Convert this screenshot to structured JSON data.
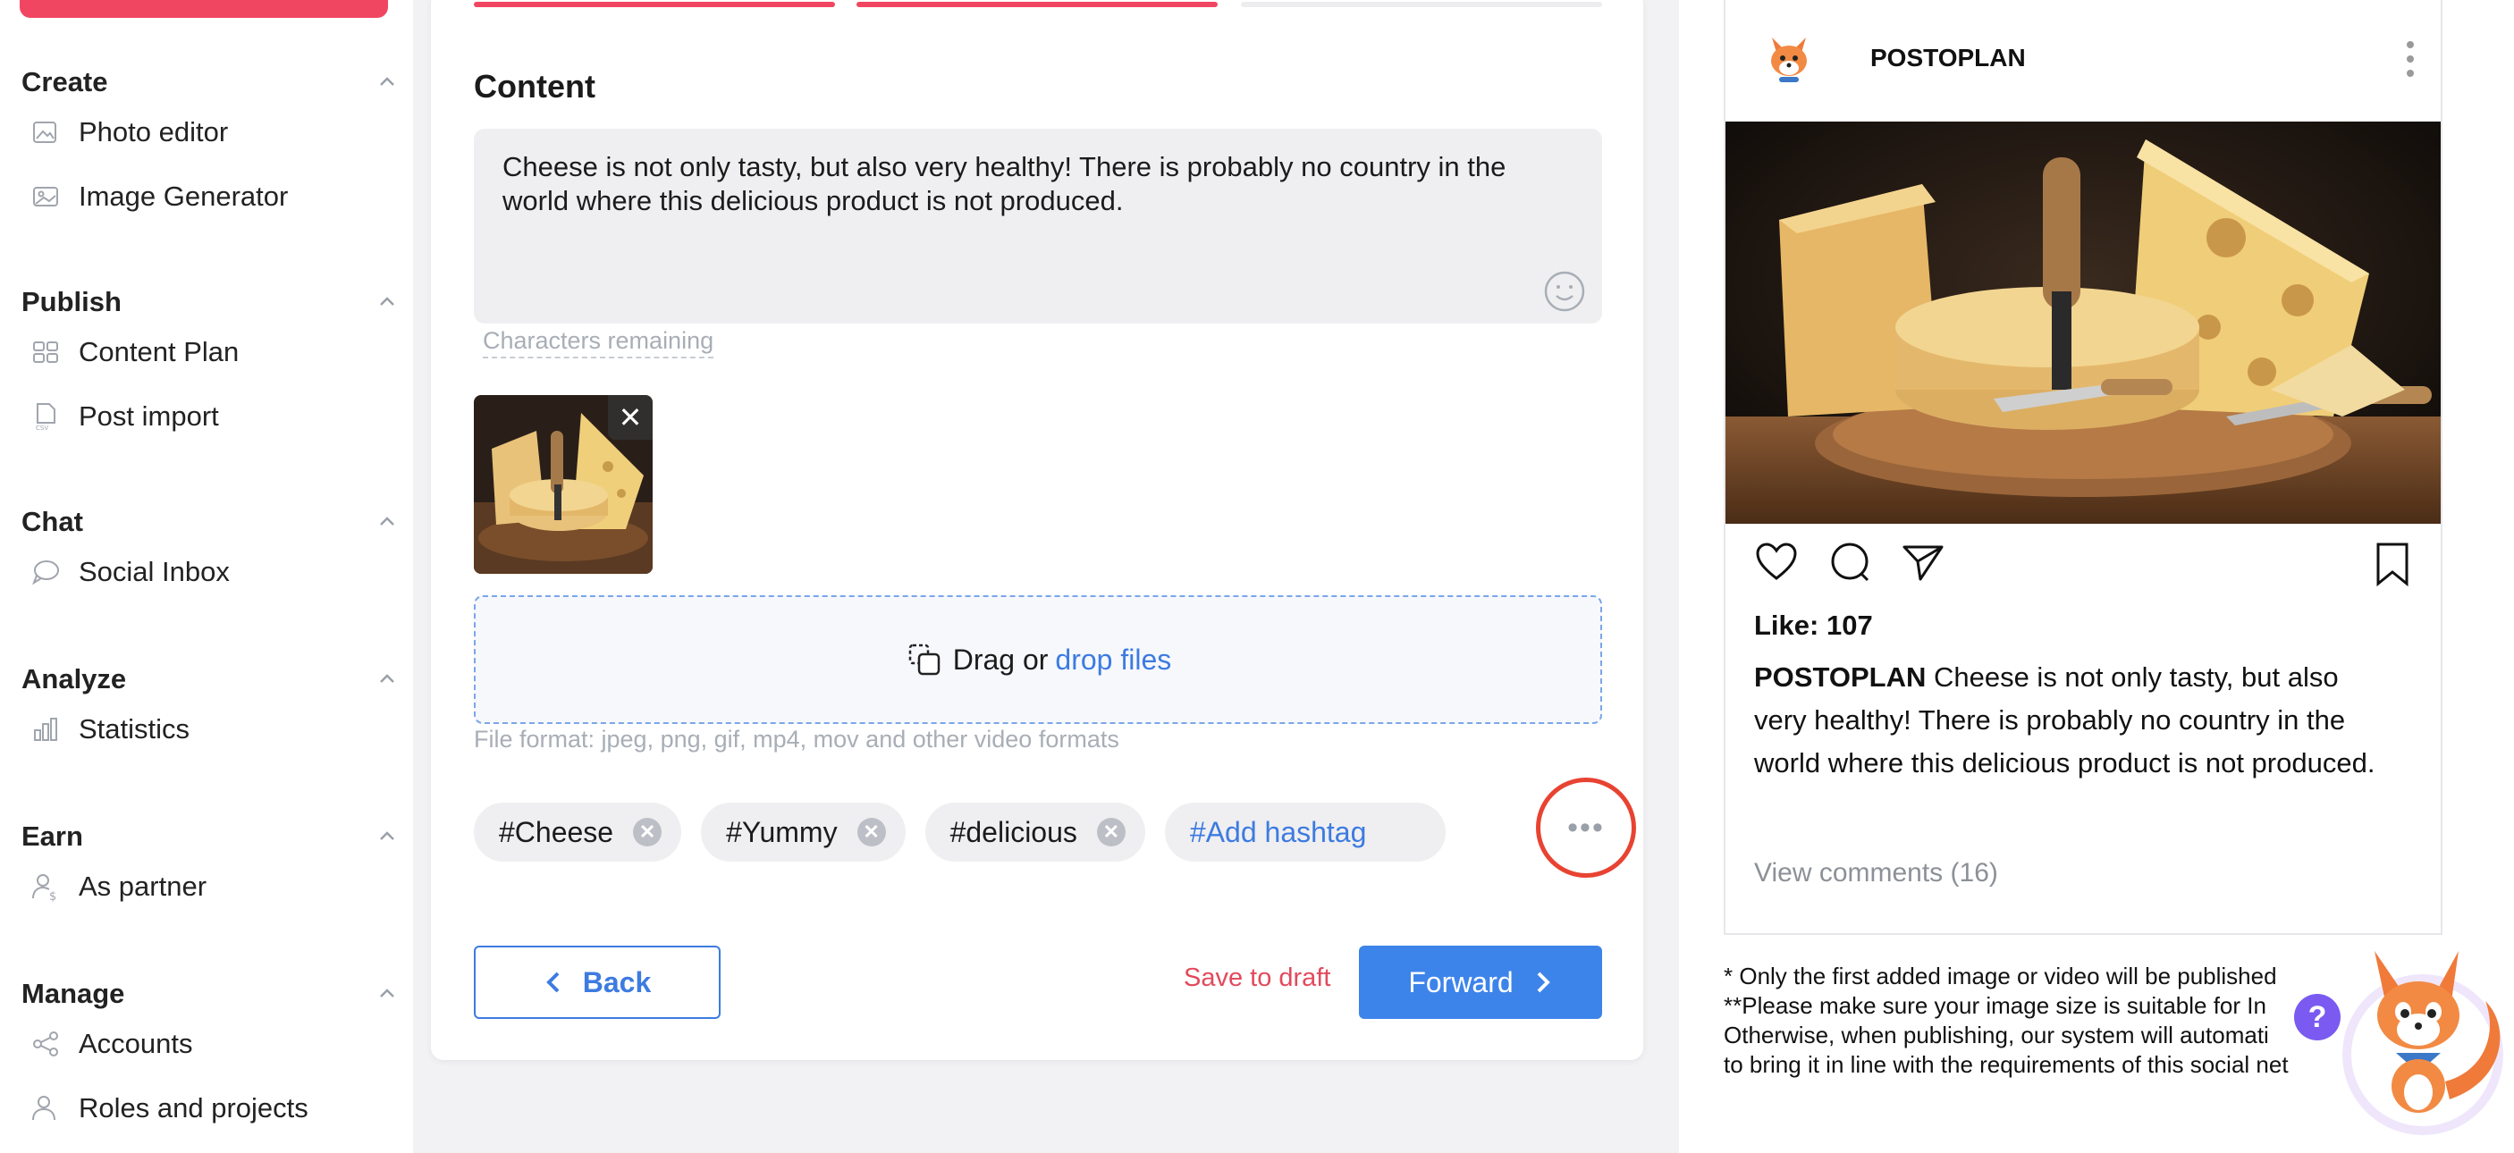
{
  "sidebar": {
    "sections": [
      {
        "title": "Create",
        "items": [
          {
            "label": "Photo editor",
            "icon": "photo-editor-icon"
          },
          {
            "label": "Image Generator",
            "icon": "image-icon"
          }
        ]
      },
      {
        "title": "Publish",
        "items": [
          {
            "label": "Content Plan",
            "icon": "grid-icon"
          },
          {
            "label": "Post import",
            "icon": "csv-file-icon"
          }
        ]
      },
      {
        "title": "Chat",
        "items": [
          {
            "label": "Social Inbox",
            "icon": "chat-bubble-icon"
          }
        ]
      },
      {
        "title": "Analyze",
        "items": [
          {
            "label": "Statistics",
            "icon": "bar-chart-icon"
          }
        ]
      },
      {
        "title": "Earn",
        "items": [
          {
            "label": "As partner",
            "icon": "partner-icon"
          }
        ]
      },
      {
        "title": "Manage",
        "items": [
          {
            "label": "Accounts",
            "icon": "share-icon"
          },
          {
            "label": "Roles and projects",
            "icon": "users-icon"
          }
        ]
      }
    ]
  },
  "editor": {
    "steps": [
      {
        "state": "done"
      },
      {
        "state": "done"
      },
      {
        "state": "pending"
      }
    ],
    "content_title": "Content",
    "text": "Cheese is not only tasty, but also very healthy!  There is probably no country in the world  where this delicious product is not produced.",
    "chars_remaining": "Characters remaining",
    "dropzone_text": "Drag or",
    "dropzone_link": "drop files",
    "formats": "File format: jpeg, png, gif, mp4, mov and other video formats",
    "hashtags": [
      "#Cheese",
      "#Yummy",
      "#delicious"
    ],
    "add_hashtag": "#Add hashtag",
    "back_label": "Back",
    "save_draft_label": "Save to draft",
    "forward_label": "Forward"
  },
  "preview": {
    "account": "POSTOPLAN",
    "likes": "Like: 107",
    "caption_user": "POSTOPLAN",
    "caption_text": "Cheese is not only tasty, but also very healthy!  There is probably no country in the world  where this delicious product is not produced.",
    "comments": "View comments (16)",
    "note_line1": "* Only the first added image or video will be published",
    "note_line2": "**Please make sure your image size is suitable for In",
    "note_line3": "Otherwise, when publishing, our system will automati",
    "note_line4": "to bring it in line with the requirements of this social net"
  },
  "colors": {
    "accent": "#3d84ea",
    "brand_red": "#f04662",
    "highlight_ring": "#e84332",
    "help": "#7a5af0"
  }
}
